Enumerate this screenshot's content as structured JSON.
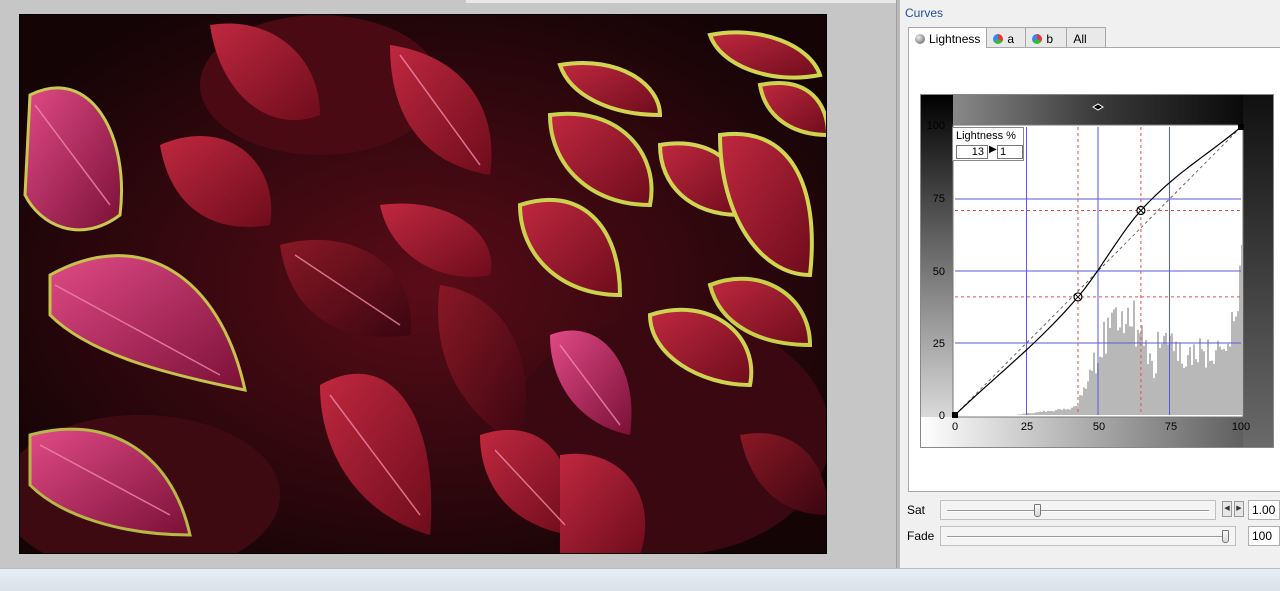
{
  "panel": {
    "title": "Curves"
  },
  "tabs": [
    {
      "label": "Lightness",
      "icon": "lightness-icon"
    },
    {
      "label": "a",
      "icon": "color-channel-icon"
    },
    {
      "label": "b",
      "icon": "color-channel-icon"
    },
    {
      "label": "All"
    }
  ],
  "curve": {
    "label_title": "Lightness %",
    "input_value": "13",
    "output_value": "1",
    "y_ticks": [
      "100",
      "75",
      "50",
      "25",
      "0"
    ],
    "x_ticks": [
      "0",
      "25",
      "50",
      "75",
      "100"
    ],
    "control_points": [
      {
        "input": 0,
        "output": 0
      },
      {
        "input": 43,
        "output": 41
      },
      {
        "input": 65,
        "output": 71
      },
      {
        "input": 100,
        "output": 100
      }
    ]
  },
  "sliders": {
    "sat": {
      "label": "Sat",
      "value": "1.00",
      "fraction": 0.34
    },
    "fade": {
      "label": "Fade",
      "value": "100",
      "fraction": 1.0
    }
  },
  "colors": {
    "panel_title": "#1f4e9c",
    "grid_blue": "#5a5ad8",
    "grid_red_dashed": "#e05050",
    "histogram": "#b8b8b8"
  }
}
